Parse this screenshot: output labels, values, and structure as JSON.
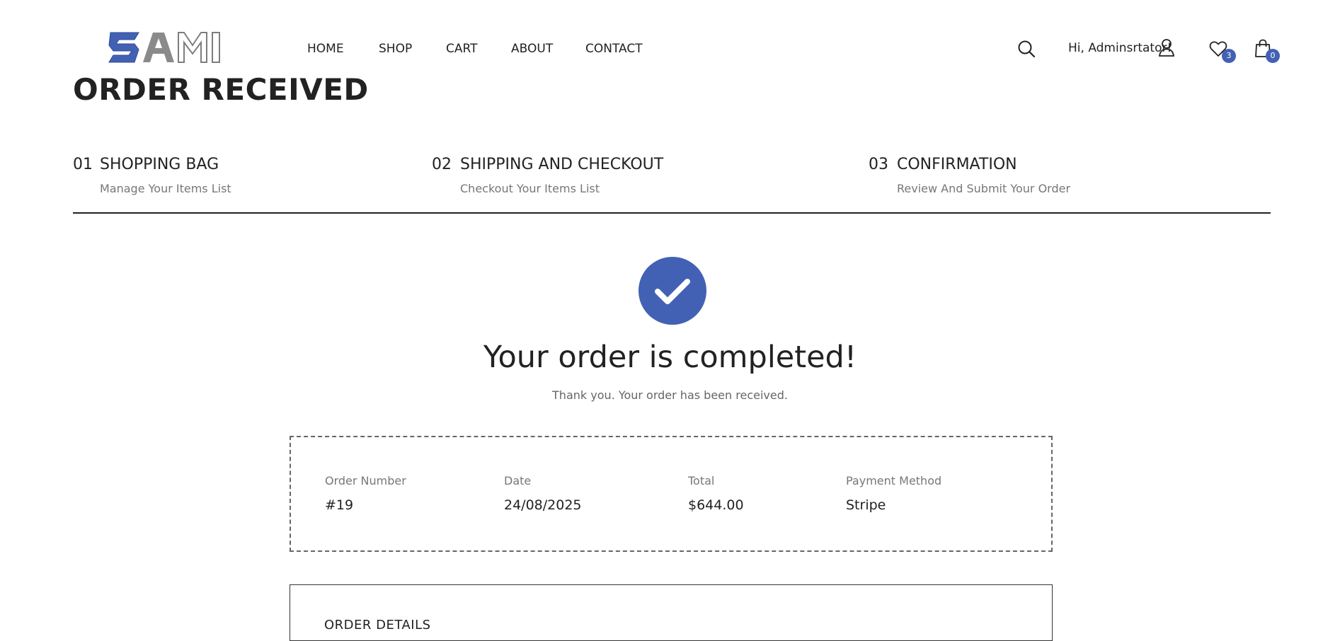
{
  "brand": {
    "logo_text": "SAMI",
    "accent": "#4361b4"
  },
  "nav": {
    "items": [
      {
        "label": "HOME"
      },
      {
        "label": "SHOP"
      },
      {
        "label": "CART"
      },
      {
        "label": "ABOUT"
      },
      {
        "label": "CONTACT"
      }
    ]
  },
  "header": {
    "greeting": "Hi, Adminsrtator!",
    "wishlist_count": "3",
    "cart_count": "0",
    "icons": [
      "search-icon",
      "user-icon",
      "heart-icon",
      "bag-icon"
    ]
  },
  "page": {
    "title": "ORDER RECEIVED"
  },
  "steps": [
    {
      "num": "01",
      "title": "SHOPPING BAG",
      "sub": "Manage Your Items List"
    },
    {
      "num": "02",
      "title": "SHIPPING AND CHECKOUT",
      "sub": "Checkout Your Items List"
    },
    {
      "num": "03",
      "title": "CONFIRMATION",
      "sub": "Review And Submit Your Order"
    }
  ],
  "confirmation": {
    "title": "Your order is completed!",
    "subtitle": "Thank you. Your order has been received."
  },
  "summary": {
    "order_number_label": "Order Number",
    "order_number": "#19",
    "date_label": "Date",
    "date": "24/08/2025",
    "total_label": "Total",
    "total": "$644.00",
    "payment_label": "Payment Method",
    "payment": "Stripe"
  },
  "details": {
    "title": "ORDER DETAILS"
  }
}
